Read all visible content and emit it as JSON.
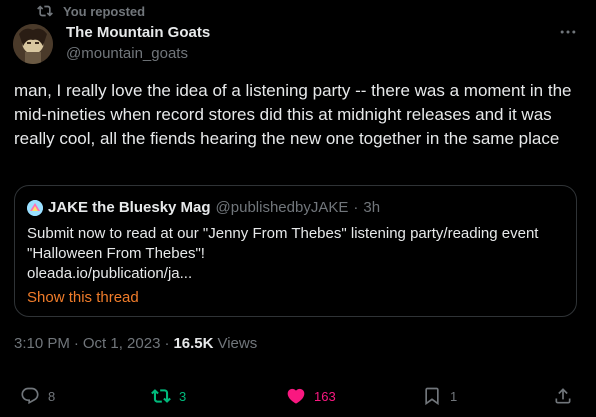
{
  "repost_banner": {
    "text": "You reposted"
  },
  "author": {
    "display_name": "The Mountain Goats",
    "handle": "@mountain_goats"
  },
  "post": {
    "text": "man, I really love the idea of a listening party -- there was a moment in the mid-nineties when record stores did this at midnight releases and it was really cool, all the fiends hearing the new one together in the same place"
  },
  "quote": {
    "author_name": "JAKE the Bluesky Mag",
    "author_handle": "@publishedbyJAKE",
    "separator": "·",
    "time": "3h",
    "body_line1": "Submit now to read at our \"Jenny From Thebes\" listening party/reading event \"Halloween From Thebes\"!",
    "link": "oleada.io/publication/ja...",
    "show_thread": "Show this thread"
  },
  "meta": {
    "time": "3:10 PM",
    "separator": "·",
    "date": "Oct 1, 2023",
    "separator2": "·",
    "views_count": "16.5K",
    "views_label": "Views"
  },
  "actions": {
    "reply_count": "8",
    "repost_count": "3",
    "like_count": "163",
    "bookmark_count": "1"
  },
  "colors": {
    "background": "#000000",
    "text": "#e7e9ea",
    "muted": "#71767b",
    "repost_active": "#00ba7c",
    "like_active": "#f91880",
    "thread_link": "#f07c2a"
  },
  "icons": [
    "repost-icon",
    "more-icon",
    "reply-icon",
    "repost-icon",
    "heart-icon",
    "bookmark-icon",
    "share-icon"
  ]
}
